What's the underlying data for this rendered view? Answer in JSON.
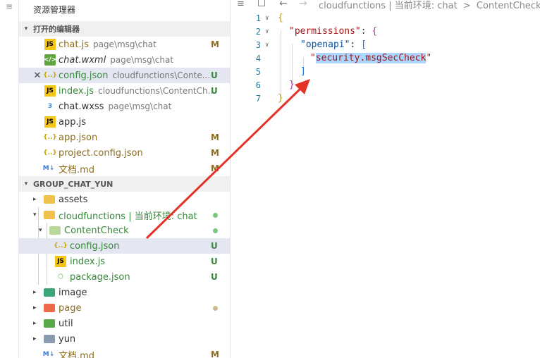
{
  "explorer": {
    "title": "资源管理器",
    "open_editors_header": "打开的编辑器",
    "open_editors": [
      {
        "name": "chat.js",
        "path": "page\\msg\\chat",
        "badge": "M",
        "icon": "js-file-icon"
      },
      {
        "name": "chat.wxml",
        "path": "page\\msg\\chat",
        "badge": "",
        "icon": "wxml-file-icon"
      },
      {
        "name": "config.json",
        "path": "cloudfunctions\\Conte...",
        "badge": "U",
        "icon": "json-file-icon"
      },
      {
        "name": "index.js",
        "path": "cloudfunctions\\ContentCh...",
        "badge": "U",
        "icon": "js-file-icon"
      },
      {
        "name": "chat.wxss",
        "path": "page\\msg\\chat",
        "badge": "",
        "icon": "css-file-icon"
      },
      {
        "name": "app.js",
        "path": "",
        "badge": "",
        "icon": "js-file-icon"
      },
      {
        "name": "app.json",
        "path": "",
        "badge": "M",
        "icon": "json-file-icon"
      },
      {
        "name": "project.config.json",
        "path": "",
        "badge": "M",
        "icon": "json-file-icon"
      },
      {
        "name": "文档.md",
        "path": "",
        "badge": "M",
        "icon": "markdown-file-icon"
      }
    ],
    "project_header": "GROUP_CHAT_YUN",
    "tree": [
      {
        "name": "assets",
        "badge": "",
        "icon": "folder-icon"
      },
      {
        "name": "cloudfunctions | 当前环境: chat",
        "badge": "dot-green",
        "icon": "folder-icon"
      },
      {
        "name": "ContentCheck",
        "badge": "dot-green",
        "icon": "folder-icon"
      },
      {
        "name": "config.json",
        "badge": "U",
        "icon": "json-file-icon"
      },
      {
        "name": "index.js",
        "badge": "U",
        "icon": "js-file-icon"
      },
      {
        "name": "package.json",
        "badge": "U",
        "icon": "package-file-icon"
      },
      {
        "name": "image",
        "badge": "",
        "icon": "folder-icon"
      },
      {
        "name": "page",
        "badge": "dot-gray",
        "icon": "folder-icon"
      },
      {
        "name": "util",
        "badge": "",
        "icon": "folder-icon"
      },
      {
        "name": "yun",
        "badge": "",
        "icon": "folder-icon"
      },
      {
        "name": "文档.md",
        "badge": "M",
        "icon": "markdown-file-icon"
      }
    ]
  },
  "editor": {
    "breadcrumb": {
      "back_icon": "←",
      "forward_icon": "→",
      "path": "cloudfunctions | 当前环境: chat",
      "sep": ">",
      "folder": "ContentCheck",
      "brace": "{"
    },
    "line_numbers": [
      "1",
      "2",
      "3",
      "4",
      "5",
      "6",
      "7"
    ],
    "code": {
      "l1": "{",
      "l2_key": "\"permissions\"",
      "l2_colon": ": ",
      "l2_open": "{",
      "l3_key": "\"openapi\"",
      "l3_colon": ": ",
      "l3_open": "[",
      "l4_q1": "\"",
      "l4_val": "security.msgSecCheck",
      "l4_q2": "\"",
      "l5": "]",
      "l6": "}",
      "l7": "}"
    }
  },
  "colors": {
    "untracked": "#38873c",
    "modified": "#8c6d1f",
    "selection": "#e4e6f1",
    "annotation_arrow": "#e53227"
  }
}
